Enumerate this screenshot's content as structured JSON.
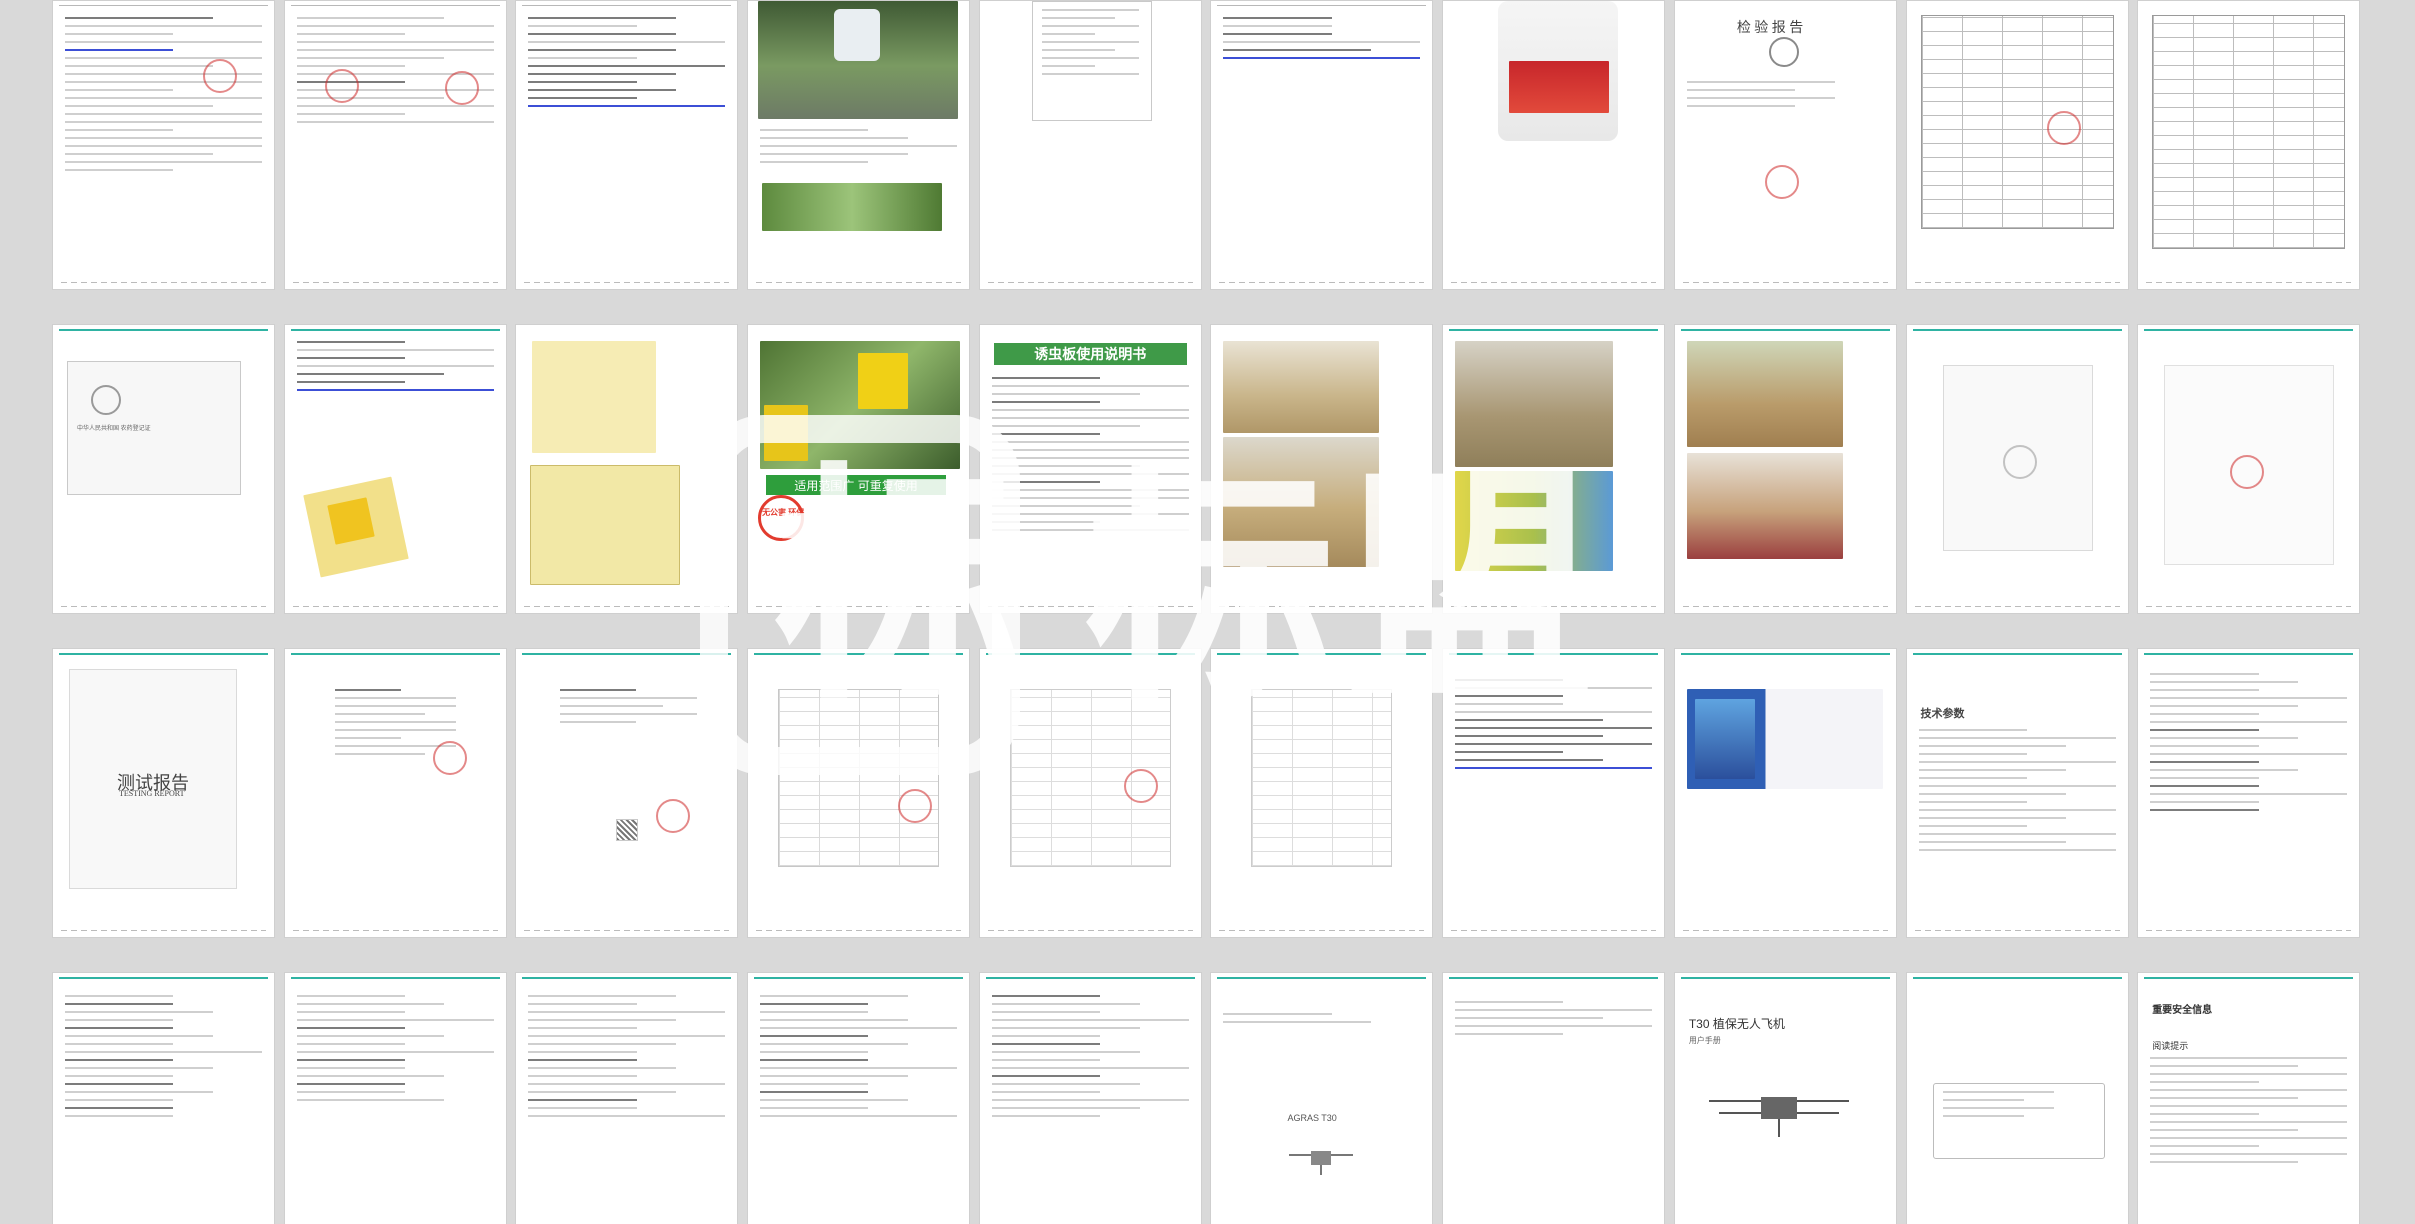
{
  "watermark": {
    "box_char": "标",
    "text": "标盟"
  },
  "pages": {
    "inspection_report_title": "检 验 报 告",
    "test_report_title_cn": "测试报告",
    "test_report_title_en": "TESTING REPORT",
    "trap_manual_title": "诱虫板使用说明书",
    "trap_badge": "无公害 环保",
    "trap_slogan": "适用范围广  可重复使用",
    "tech_params_title": "技术参数",
    "drone_manual_title": "T30 植保无人飞机",
    "drone_manual_subtitle": "用户手册",
    "drone_cover_model": "AGRAS T30",
    "safety_title": "重要安全信息",
    "safety_sub": "阅读提示",
    "reg_cert_title": "中华人民共和国 农药登记证"
  },
  "colors": {
    "teal": "#2fb3a3",
    "trap_yellow": "#f2e08a",
    "green": "#3f9a48",
    "stamp_red": "#cd2828",
    "link_blue": "#3c4fd6"
  }
}
